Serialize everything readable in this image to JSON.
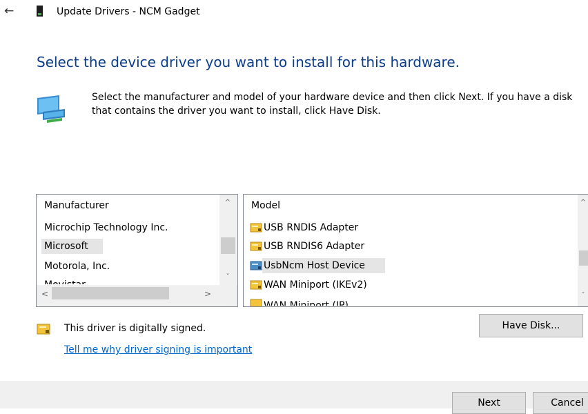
{
  "window": {
    "title": "Update Drivers - NCM Gadget",
    "back_icon": "arrow-left-icon",
    "title_icon": "device-icon"
  },
  "heading": "Select the device driver you want to install for this hardware.",
  "description": "Select the manufacturer and model of your hardware device and then click Next. If you have a disk that contains the driver you want to install, click Have Disk.",
  "manufacturer_list": {
    "header": "Manufacturer",
    "items": [
      "Microchip Technology Inc.",
      "Microsoft",
      "Motorola, Inc.",
      "Movistar"
    ],
    "selected": "Microsoft"
  },
  "model_list": {
    "header": "Model",
    "items": [
      "USB RNDIS Adapter",
      "USB RNDIS6 Adapter",
      "UsbNcm Host Device",
      "WAN Miniport (IKEv2)",
      "WAN Miniport (IP)"
    ],
    "selected": "UsbNcm Host Device"
  },
  "signing": {
    "status": "This driver is digitally signed.",
    "link": "Tell me why driver signing is important",
    "icon": "signed-driver-icon"
  },
  "buttons": {
    "have_disk": "Have Disk...",
    "next": "Next",
    "cancel": "Cancel"
  },
  "colors": {
    "heading": "#0b3c8c",
    "link": "#0066cc",
    "selection": "#e5e5e5"
  }
}
